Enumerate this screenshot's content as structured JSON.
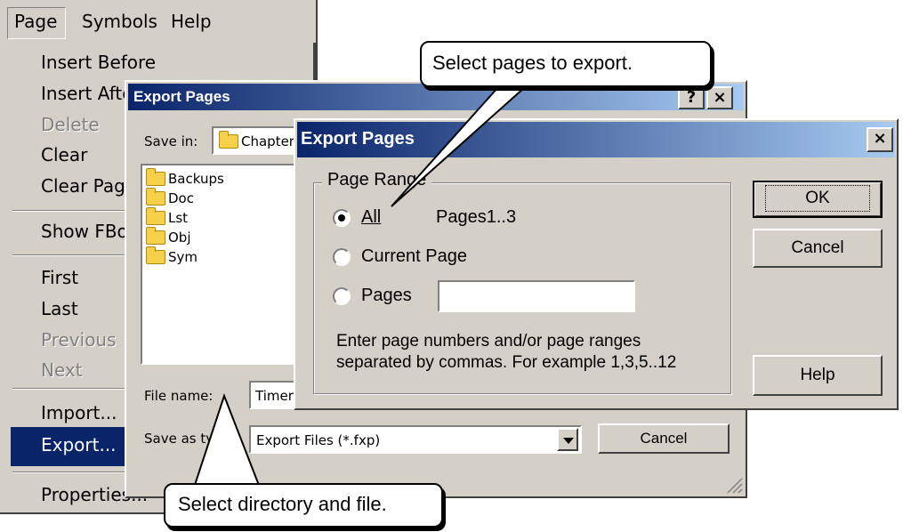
{
  "menubar": {
    "items": [
      "Page",
      "Symbols",
      "Help"
    ]
  },
  "menu": {
    "items": [
      {
        "label": "Insert Before",
        "disabled": false
      },
      {
        "label": "Insert After",
        "disabled": false
      },
      {
        "label": "Delete",
        "disabled": true
      },
      {
        "label": "Clear",
        "disabled": false
      },
      {
        "label": "Clear Page",
        "disabled": false
      },
      {
        "label": "Show FBox",
        "disabled": false
      },
      {
        "label": "First",
        "disabled": false
      },
      {
        "label": "Last",
        "disabled": false
      },
      {
        "label": "Previous",
        "disabled": true
      },
      {
        "label": "Next",
        "disabled": true
      },
      {
        "label": "Import...",
        "disabled": false
      },
      {
        "label": "Export...",
        "disabled": false,
        "selected": true
      },
      {
        "label": "Properties...",
        "disabled": false
      }
    ]
  },
  "file_dialog": {
    "title": "Export Pages",
    "save_in_label": "Save in:",
    "save_in_value": "Chapter",
    "folders": [
      "Backups",
      "Doc",
      "Lst",
      "Obj",
      "Sym"
    ],
    "file_name_label": "File name:",
    "file_name_value": "Timer",
    "save_as_label": "Save as type:",
    "save_as_value": "Export Files (*.fxp)",
    "cancel_label": "Cancel",
    "help_btn": "?",
    "close_btn": "×"
  },
  "range_dialog": {
    "title": "Export Pages",
    "close_btn": "×",
    "group_label": "Page Range",
    "options": [
      {
        "label": "All",
        "checked": true,
        "accel": "A"
      },
      {
        "label": "Current Page",
        "checked": false,
        "accel": "C"
      },
      {
        "label": "Pages",
        "checked": false
      }
    ],
    "pages_summary": "Pages1..3",
    "pages_input_value": "",
    "hint_line1": "Enter page numbers and/or page ranges",
    "hint_line2": "separated by commas. For example 1,3,5..12",
    "ok_label": "OK",
    "cancel_label": "Cancel",
    "help_label": "Help"
  },
  "callouts": {
    "top": "Select pages to export.",
    "bottom": "Select directory and file."
  }
}
